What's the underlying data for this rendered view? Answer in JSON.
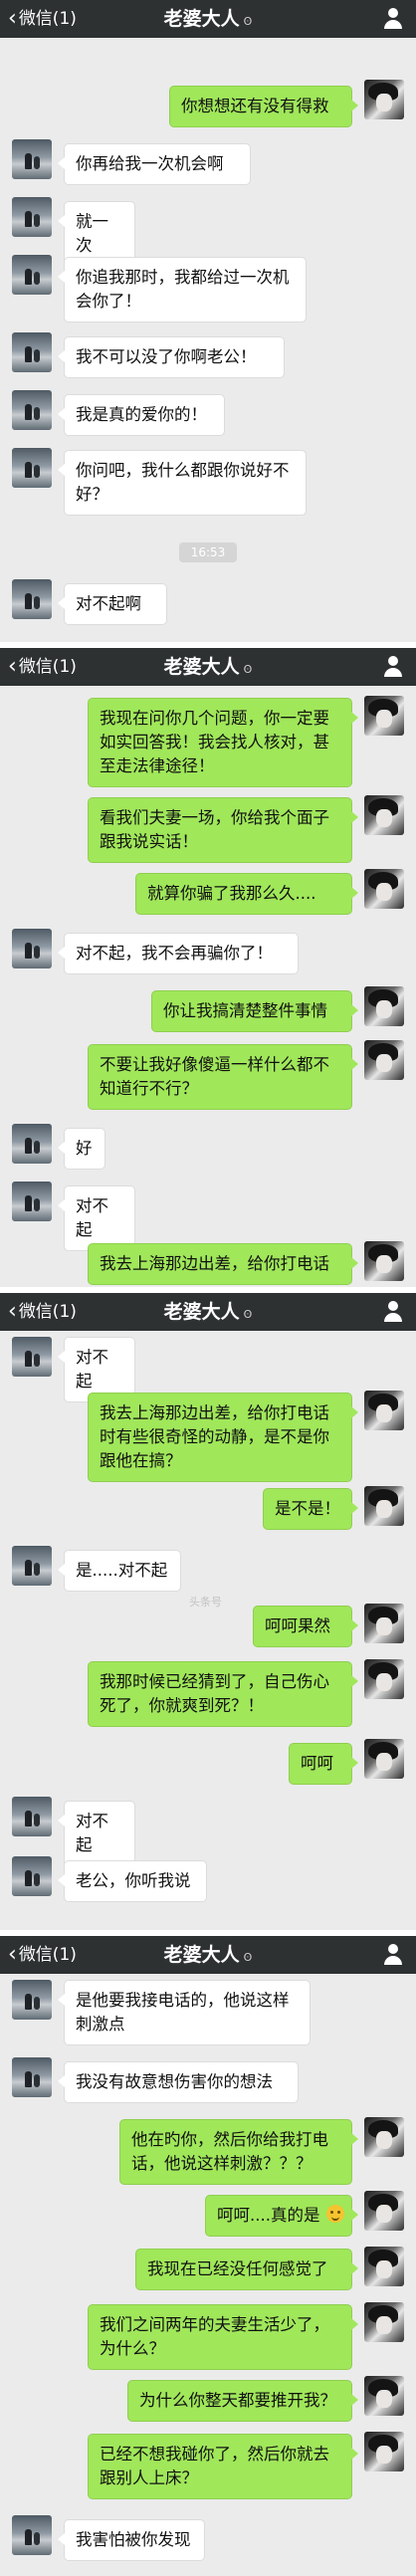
{
  "header": {
    "back_label": "微信(1)",
    "title": "老婆大人"
  },
  "time_stamp": "16:53",
  "watermark": "头条号",
  "screens": [
    {
      "messages": [
        {
          "side": "right",
          "text": "你想想还有没有得救"
        },
        {
          "side": "left",
          "text": "你再给我一次机会啊"
        },
        {
          "side": "left",
          "text": "就一次"
        },
        {
          "side": "left",
          "text": "你追我那时，我都给过一次机会你了！"
        },
        {
          "side": "left",
          "text": "我不可以没了你啊老公！"
        },
        {
          "side": "left",
          "text": "我是真的爱你的！"
        },
        {
          "side": "left",
          "text": "你问吧，我什么都跟你说好不好？"
        },
        {
          "side": "left",
          "text": "对不起啊"
        }
      ]
    },
    {
      "messages": [
        {
          "side": "right",
          "text": "我现在问你几个问题，你一定要如实回答我！我会找人核对，甚至走法律途径！"
        },
        {
          "side": "right",
          "text": "看我们夫妻一场，你给我个面子跟我说实话！"
        },
        {
          "side": "right",
          "text": "就算你骗了我那么久...."
        },
        {
          "side": "left",
          "text": "对不起，我不会再骗你了！"
        },
        {
          "side": "right",
          "text": "你让我搞清楚整件事情"
        },
        {
          "side": "right",
          "text": "不要让我好像傻逼一样什么都不知道行不行？"
        },
        {
          "side": "left",
          "text": "好"
        },
        {
          "side": "left",
          "text": "对不起"
        },
        {
          "side": "right",
          "text": "我去上海那边出差，给你打电话"
        }
      ]
    },
    {
      "messages": [
        {
          "side": "left",
          "text": "对不起"
        },
        {
          "side": "right",
          "text": "我去上海那边出差，给你打电话时有些很奇怪的动静，是不是你跟他在搞？"
        },
        {
          "side": "right",
          "text": "是不是！"
        },
        {
          "side": "left",
          "text": "是.....对不起"
        },
        {
          "side": "right",
          "text": "呵呵果然"
        },
        {
          "side": "right",
          "text": "我那时候已经猜到了，自己伤心死了，你就爽到死？！"
        },
        {
          "side": "right",
          "text": "呵呵"
        },
        {
          "side": "left",
          "text": "对不起"
        },
        {
          "side": "left",
          "text": "老公，你听我说"
        }
      ]
    },
    {
      "messages": [
        {
          "side": "left",
          "text": "是他要我接电话的，他说这样刺激点"
        },
        {
          "side": "left",
          "text": "我没有故意想伤害你的想法"
        },
        {
          "side": "right",
          "text": "他在旳你，然后你给我打电话，他说这样刺激？？？"
        },
        {
          "side": "right",
          "text": "呵呵....真的是"
        },
        {
          "side": "right",
          "text": "我现在已经没任何感觉了"
        },
        {
          "side": "right",
          "text": "我们之间两年的夫妻生活少了，为什么？"
        },
        {
          "side": "right",
          "text": "为什么你整天都要推开我？"
        },
        {
          "side": "right",
          "text": "已经不想我碰你了，然后你就去跟别人上床？"
        },
        {
          "side": "left",
          "text": "我害怕被你发现"
        }
      ]
    }
  ]
}
